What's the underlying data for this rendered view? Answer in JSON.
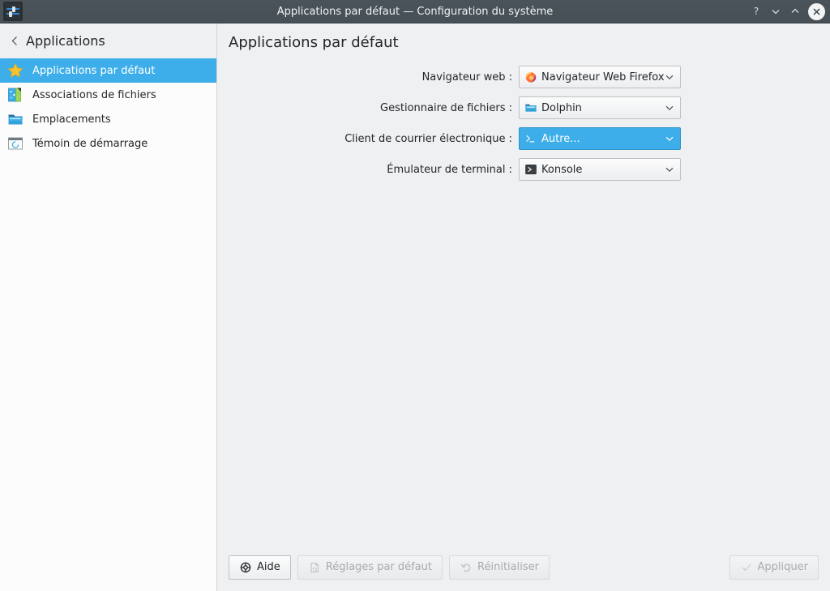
{
  "window": {
    "title": "Applications par défaut — Configuration du système",
    "app_icon": "system-settings-sliders-icon",
    "controls": {
      "help": "?",
      "minimize": "v",
      "maximize": "^",
      "close": "x"
    }
  },
  "sidebar": {
    "back_label": "Applications",
    "items": [
      {
        "label": "Applications par défaut",
        "icon": "star-icon",
        "selected": true
      },
      {
        "label": "Associations de fichiers",
        "icon": "file-associations-icon",
        "selected": false
      },
      {
        "label": "Emplacements",
        "icon": "folder-icon",
        "selected": false
      },
      {
        "label": "Témoin de démarrage",
        "icon": "launch-feedback-icon",
        "selected": false
      }
    ]
  },
  "main": {
    "page_title": "Applications par défaut",
    "rows": [
      {
        "label": "Navigateur web :",
        "value": "Navigateur Web Firefox",
        "icon": "firefox-icon",
        "active": false
      },
      {
        "label": "Gestionnaire de fichiers :",
        "value": "Dolphin",
        "icon": "dolphin-folder-icon",
        "active": false
      },
      {
        "label": "Client de courrier électronique :",
        "value": "Autre...",
        "icon": "terminal-prompt-icon",
        "active": true
      },
      {
        "label": "Émulateur de terminal :",
        "value": "Konsole",
        "icon": "konsole-icon",
        "active": false
      }
    ]
  },
  "footer": {
    "help": {
      "label": "Aide",
      "icon": "lifebuoy-icon",
      "enabled": true
    },
    "defaults": {
      "label": "Réglages par défaut",
      "icon": "document-revert-icon",
      "enabled": false
    },
    "reset": {
      "label": "Réinitialiser",
      "icon": "undo-arrow-icon",
      "enabled": false
    },
    "apply": {
      "label": "Appliquer",
      "icon": "check-icon",
      "enabled": false
    }
  },
  "colors": {
    "titlebar": "#475056",
    "highlight": "#3daee9",
    "window_bg": "#eff0f1",
    "list_bg": "#fcfcfc",
    "text": "#232629",
    "disabled_text": "#a8abad"
  }
}
